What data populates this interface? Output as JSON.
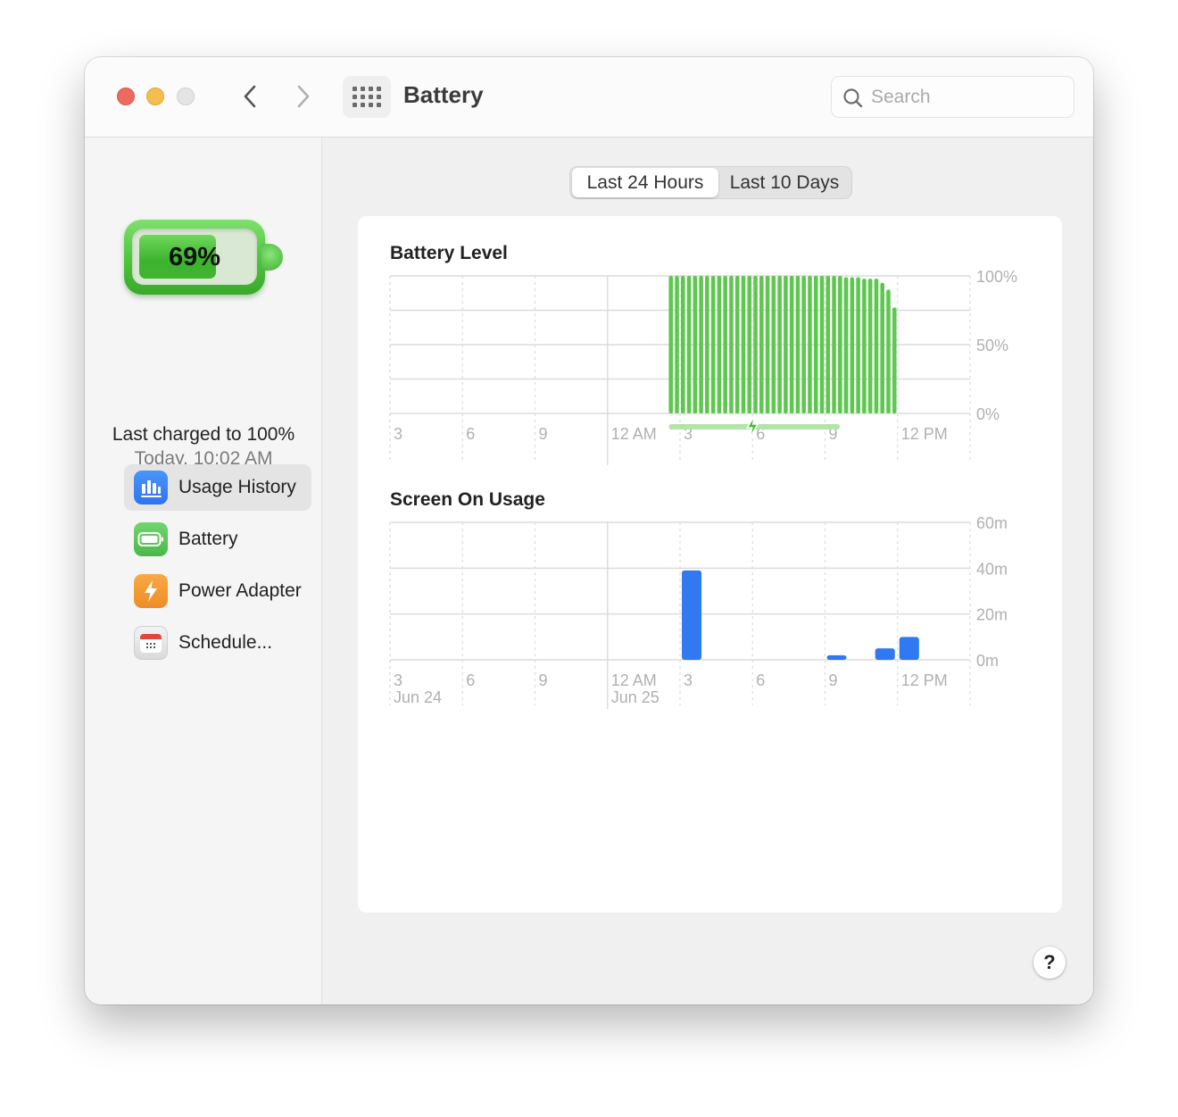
{
  "window": {
    "title": "Battery",
    "search": {
      "placeholder": "Search",
      "value": ""
    },
    "traffic_lights": [
      "close",
      "minimize",
      "zoom"
    ],
    "nav": {
      "back_icon": "chevron-left-icon",
      "forward_icon": "chevron-right-icon",
      "grid_icon": "app-grid-icon"
    }
  },
  "sidebar": {
    "battery_percent": "69%",
    "battery_level": 0.69,
    "last_charged_line": "Last charged to 100%",
    "last_charged_time": "Today, 10:02 AM",
    "items": [
      {
        "label": "Usage History",
        "icon": "bar-chart-icon",
        "active": true
      },
      {
        "label": "Battery",
        "icon": "battery-icon",
        "active": false
      },
      {
        "label": "Power Adapter",
        "icon": "lightning-icon",
        "active": false
      },
      {
        "label": "Schedule...",
        "icon": "calendar-icon",
        "active": false
      }
    ]
  },
  "main": {
    "segments": [
      {
        "label": "Last 24 Hours",
        "selected": true
      },
      {
        "label": "Last 10 Days",
        "selected": false
      }
    ],
    "help_label": "?"
  },
  "colors": {
    "battery_green": "#5ec750",
    "charging_bar": "#b3e3a9",
    "usage_blue": "#3079f0",
    "grid": "#dcdcdc",
    "tick_text": "#b0b0b0"
  },
  "chart_data": [
    {
      "type": "bar",
      "title": "Battery Level",
      "x_ticks": [
        "3",
        "6",
        "9",
        "12 AM",
        "3",
        "6",
        "9",
        "12 PM"
      ],
      "x_tick_hours": [
        3,
        6,
        9,
        12,
        15,
        18,
        21,
        24
      ],
      "x_range_hours": [
        3,
        27
      ],
      "y_ticks": [
        "100%",
        "50%",
        "0%"
      ],
      "ylim": [
        0,
        100
      ],
      "grid": true,
      "series": [
        {
          "name": "Battery Level",
          "start_hour": 14.5,
          "step_hours": 0.25,
          "values": [
            100,
            100,
            100,
            100,
            100,
            100,
            100,
            100,
            100,
            100,
            100,
            100,
            100,
            100,
            100,
            100,
            100,
            100,
            100,
            100,
            100,
            100,
            100,
            100,
            100,
            100,
            100,
            100,
            100,
            99,
            99,
            99,
            98,
            98,
            98,
            95,
            90,
            77
          ]
        }
      ],
      "charging_period_hours": [
        14.5,
        21.5
      ],
      "charging_icon": "lightning-icon"
    },
    {
      "type": "bar",
      "title": "Screen On Usage",
      "x_ticks": [
        "3",
        "6",
        "9",
        "12 AM",
        "3",
        "6",
        "9",
        "12 PM"
      ],
      "x_tick_hours": [
        3,
        6,
        9,
        12,
        15,
        18,
        21,
        24
      ],
      "x_range_hours": [
        3,
        27
      ],
      "date_labels": [
        {
          "label": "Jun 24",
          "hour": 3
        },
        {
          "label": "Jun 25",
          "hour": 12
        }
      ],
      "y_ticks": [
        "60m",
        "40m",
        "20m",
        "0m"
      ],
      "ylim": [
        0,
        60
      ],
      "ylabel_unit": "minutes",
      "grid": true,
      "series": [
        {
          "name": "Screen On",
          "hours": [
            15,
            21,
            23,
            24
          ],
          "values": [
            39,
            2,
            5,
            10
          ]
        }
      ]
    }
  ]
}
